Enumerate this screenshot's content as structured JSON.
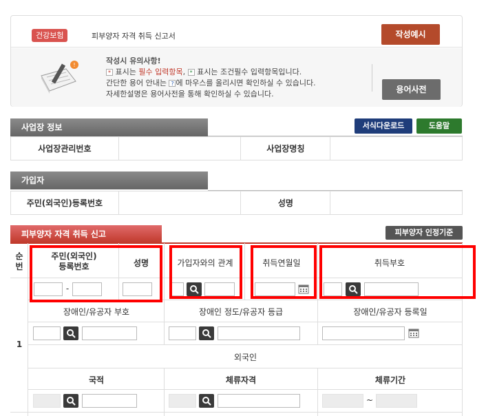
{
  "top": {
    "badge": "건강보험",
    "form_title": "피부양자 자격 취득 신고서",
    "example_button": "작성예시",
    "notice_title": "작성시 유의사항!",
    "notice_line1_a": "표시는",
    "notice_line1_req": "필수 입력항목",
    "notice_line1_b": ",",
    "notice_line1_c": "표시는 조건필수 입력항목입니다.",
    "notice_line2": "간단한 용어 안내는",
    "notice_line2_b": "에 마우스를 올리시면 확인하실 수 있습니다.",
    "notice_line3": "자세한설명은 용어사전을 통해 확인하실 수 있습니다.",
    "dict_button": "용어사전"
  },
  "workplace": {
    "section_title": "사업장 정보",
    "download_button": "서식다운로드",
    "help_button": "도움말",
    "mgmt_no_label": "사업장관리번호",
    "name_label": "사업장명칭"
  },
  "subscriber": {
    "section_title": "가입자",
    "id_label": "주민(외국인)등록번호",
    "name_label": "성명"
  },
  "dependent": {
    "section_title": "피부양자 자격 취득 신고",
    "criteria_button": "피부양자 인정기준",
    "col_seq": "순\n번",
    "col_id": "주민(외국인)\n등록번호",
    "col_name": "성명",
    "col_relation": "가입자와의 관계",
    "col_date": "취득연월일",
    "col_code": "취득부호",
    "id_separator": "-",
    "row_no": "1",
    "disabled_code": "장애인/유공자 부호",
    "disabled_grade": "장애인 정도/유공자 등급",
    "disabled_date": "장애인/유공자 등록일",
    "foreigner": "외국인",
    "nationality": "국적",
    "residence_status": "체류자격",
    "residence_period": "체류기간",
    "period_separator": "~"
  },
  "colors": {
    "accent_red": "#ff0000",
    "example_btn": "#b44a2b",
    "download_btn": "#1f3d7a",
    "help_btn": "#2d7a2d"
  }
}
